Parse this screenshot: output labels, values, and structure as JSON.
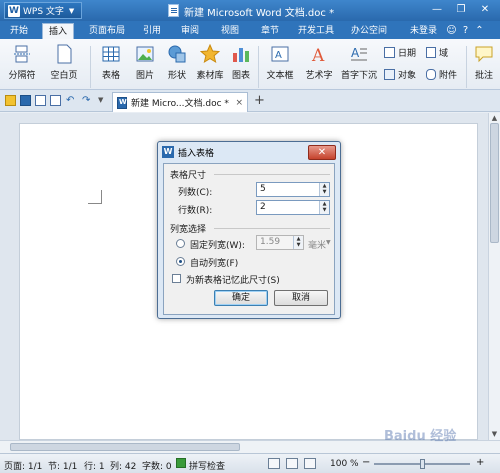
{
  "titlebar": {
    "app_name": "WPS 文字",
    "title": "新建 Microsoft Word 文档.doc *",
    "controls": [
      "minimize-icon",
      "maximize-icon",
      "close-icon"
    ]
  },
  "tabs": {
    "items": [
      "开始",
      "插入",
      "页面布局",
      "引用",
      "审阅",
      "视图",
      "章节",
      "开发工具",
      "办公空间"
    ],
    "active": "插入",
    "login": "未登录"
  },
  "ribbon": {
    "page_break": "分隔符",
    "blank_page": "空白页",
    "table": "表格",
    "picture": "图片",
    "shape": "形状",
    "clipart": "素材库",
    "chart": "图表",
    "textbox": "文本框",
    "wordart": "艺术字",
    "dropcap": "首字下沉",
    "date": "日期",
    "field": "域",
    "object": "对象",
    "attachment": "附件",
    "comment": "批注"
  },
  "doctab": {
    "label": "新建 Micro...文档.doc *",
    "close": "×",
    "new_tab": "+"
  },
  "dialog": {
    "title": "插入表格",
    "close_symbol": "✕",
    "group_size": "表格尺寸",
    "cols_label": "列数(C):",
    "cols_value": "5",
    "rows_label": "行数(R):",
    "rows_value": "2",
    "group_width": "列宽选择",
    "fixed_width_label": "固定列宽(W):",
    "fixed_width_value": "1.59",
    "unit": "毫米",
    "auto_width_label": "自动列宽(F)",
    "remember_label": "为新表格记忆此尺寸(S)",
    "ok": "确定",
    "cancel": "取消"
  },
  "status": {
    "page": "页面: 1/1",
    "section": "节: 1/1",
    "row": "行: 1",
    "col": "列: 42",
    "words": "字数: 0",
    "spellcheck": "拼写检查",
    "zoom": "100 %"
  },
  "watermark": "Baidu 经验"
}
